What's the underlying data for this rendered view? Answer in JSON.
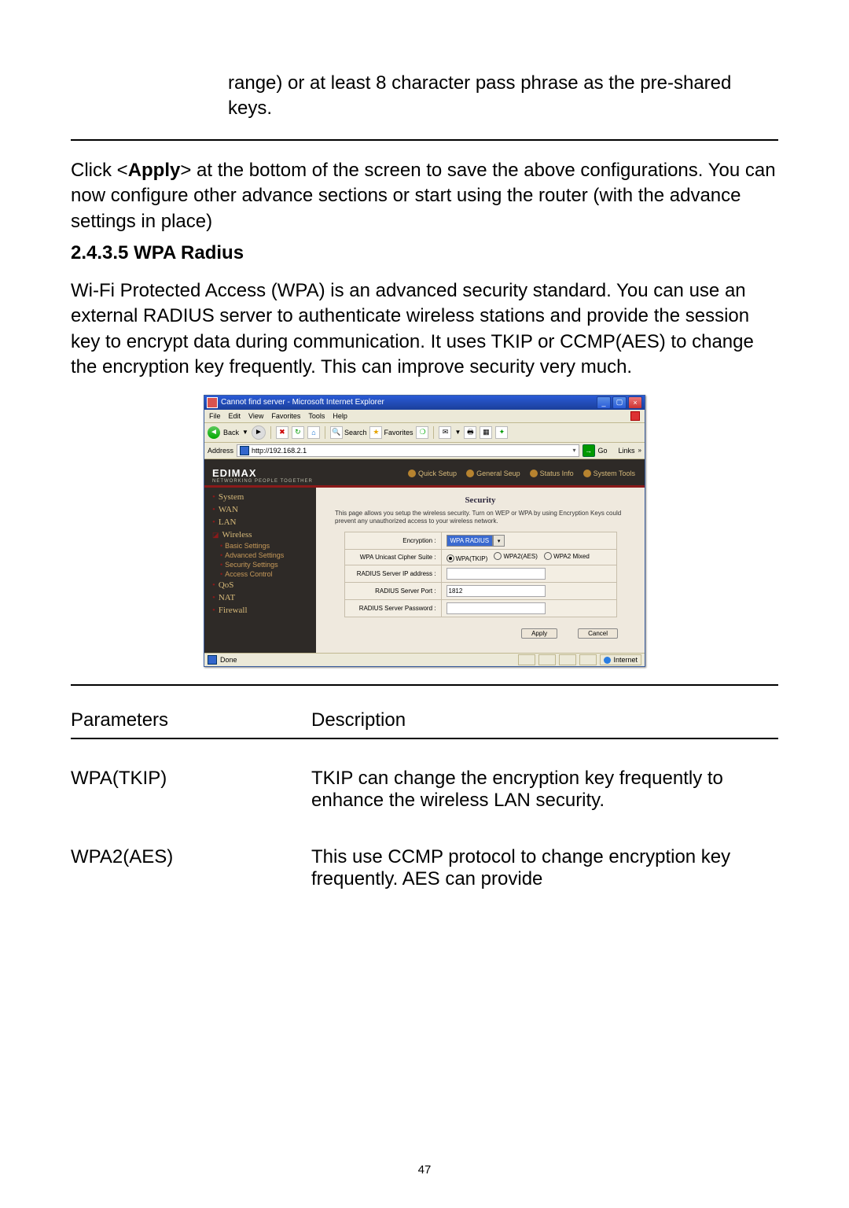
{
  "intro_fragment": "range) or at least 8 character pass phrase as the pre-shared keys.",
  "apply_note_a": "Click <",
  "apply_note_bold": "Apply",
  "apply_note_b": "> at the bottom of the screen to save the above configurations. You can now configure other advance sections or start using the router (with the advance settings in place)",
  "heading": "2.4.3.5 WPA Radius",
  "body": "Wi-Fi Protected Access (WPA) is an advanced security standard. You can use an external RADIUS server to authenticate wireless stations and provide the session key to encrypt data during communication. It uses TKIP or CCMP(AES) to change the encryption key frequently. This can improve security very much.",
  "table": {
    "hcol1": "Parameters",
    "hcol2": "Description",
    "rows": [
      {
        "p": "WPA(TKIP)",
        "d": "TKIP can change the encryption key frequently to enhance the wireless LAN security."
      },
      {
        "p": "WPA2(AES)",
        "d": "This use CCMP protocol to change encryption key frequently. AES can provide"
      }
    ]
  },
  "page_number": "47",
  "shot": {
    "title": "Cannot find server - Microsoft Internet Explorer",
    "menus": [
      "File",
      "Edit",
      "View",
      "Favorites",
      "Tools",
      "Help"
    ],
    "back": "Back",
    "search": "Search",
    "favorites": "Favorites",
    "addr_label": "Address",
    "addr_value": "http://192.168.2.1",
    "go": "Go",
    "links": "Links",
    "logo": "EDIMAX",
    "logo_small": "NETWORKING PEOPLE TOGETHER",
    "tabs": [
      "Quick Setup",
      "General Seup",
      "Status Info",
      "System Tools"
    ],
    "side": {
      "system": "System",
      "wan": "WAN",
      "lan": "LAN",
      "wireless": "Wireless",
      "subs": [
        "Basic Settings",
        "Advanced Settings",
        "Security Settings",
        "Access Control"
      ],
      "qos": "QoS",
      "nat": "NAT",
      "firewall": "Firewall"
    },
    "panel": {
      "h": "Security",
      "desc": "This page allows you setup the wireless security. Turn on WEP or WPA by using Encryption Keys could prevent any unauthorized access to your wireless network.",
      "fields": {
        "enc_lbl": "Encryption :",
        "enc_val": "WPA RADIUS",
        "suite_lbl": "WPA Unicast Cipher Suite :",
        "r1": "WPA(TKIP)",
        "r2": "WPA2(AES)",
        "r3": "WPA2 Mixed",
        "ip_lbl": "RADIUS Server IP address :",
        "port_lbl": "RADIUS Server Port :",
        "port_val": "1812",
        "pw_lbl": "RADIUS Server Password :"
      },
      "apply": "Apply",
      "cancel": "Cancel"
    },
    "status_done": "Done",
    "status_inet": "Internet"
  }
}
